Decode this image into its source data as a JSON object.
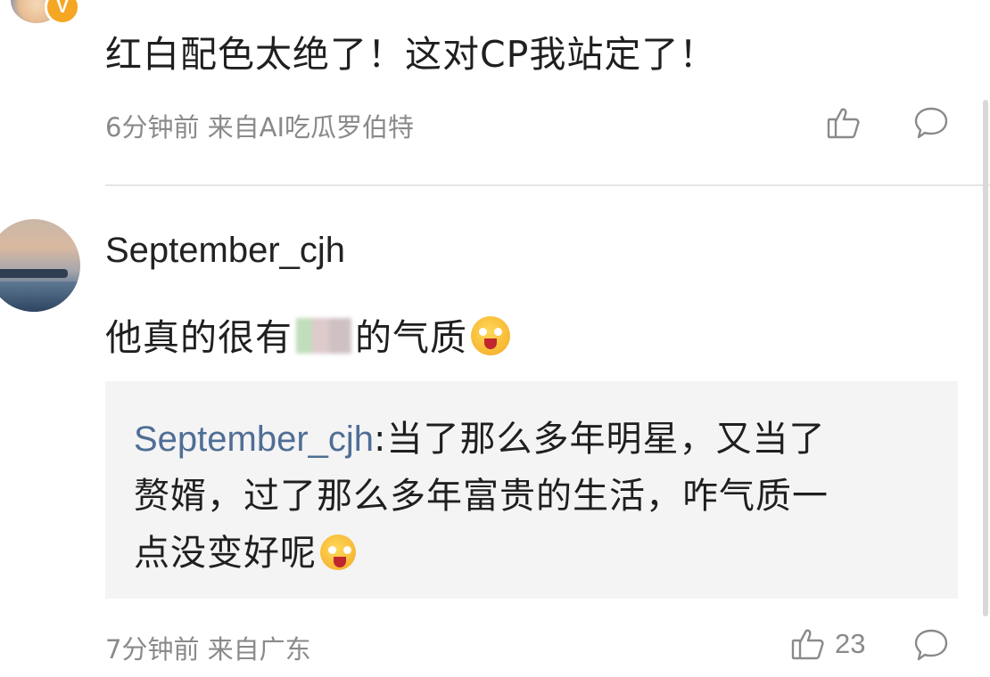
{
  "comment1": {
    "badge": "V",
    "text": "红白配色太绝了！这对CP我站定了！",
    "meta": "6分钟前 来自AI吃瓜罗伯特"
  },
  "comment2": {
    "username": "September_cjh",
    "text_before": "他真的很有",
    "text_after": "的气质",
    "reply": {
      "user": "September_cjh",
      "line1": ":当了那么多年明星，又当了",
      "line2": "赘婿，过了那么多年富贵的生活，咋气质一",
      "line3": "点没变好呢"
    },
    "meta": "7分钟前 来自广东",
    "like_count": "23"
  },
  "icons": {
    "like": "thumbs-up-icon",
    "comment": "speech-bubble-icon",
    "emoji": "sly-grin-emoji-icon"
  },
  "colors": {
    "reply_username": "#4f6e95",
    "meta_text": "#8a8a8a",
    "reply_bg": "#f4f4f4"
  }
}
